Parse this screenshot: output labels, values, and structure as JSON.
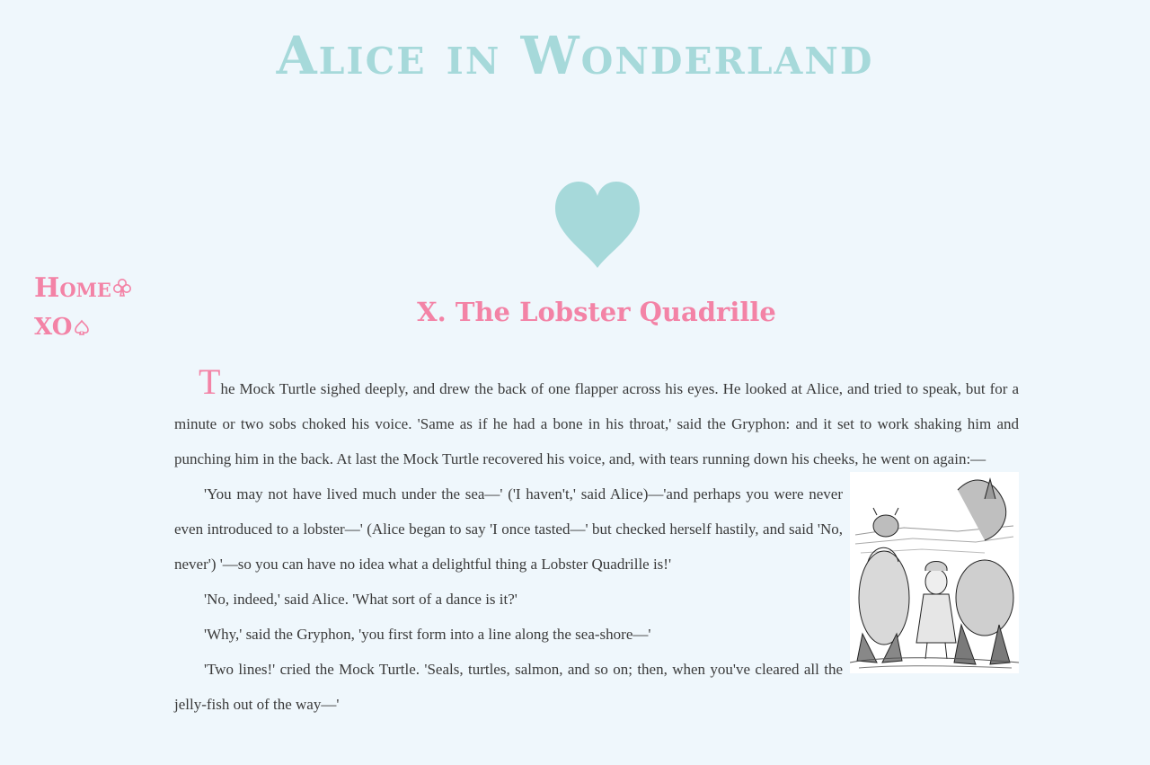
{
  "site": {
    "title": "Alice in Wonderland"
  },
  "nav": {
    "items": [
      {
        "label": "Home",
        "icon": "club-outline-icon"
      },
      {
        "label": "XO",
        "icon": "spade-outline-icon"
      }
    ]
  },
  "colors": {
    "background": "#eff7fc",
    "accent_teal": "#a6d9da",
    "accent_pink": "#f383a6",
    "body_text": "#3a3a3a"
  },
  "chapter": {
    "title": "X. The Lobster Quadrille",
    "drop_cap": "T",
    "paragraphs": [
      "he Mock Turtle sighed deeply, and drew the back of one flapper across his eyes. He looked at Alice, and tried to speak, but for a minute or two sobs choked his voice. 'Same as if he had a bone in his throat,' said the Gryphon: and it set to work shaking him and punching him in the back. At last the Mock Turtle recovered his voice, and, with tears running down his cheeks, he went on again:—",
      "'You may not have lived much under the sea—' ('I haven't,' said Alice)—'and perhaps you were never even introduced to a lobster—' (Alice began to say 'I once tasted—' but checked herself hastily, and said 'No, never') '—so you can have no idea what a delightful thing a Lobster Quadrille is!'",
      "'No, indeed,' said Alice. 'What sort of a dance is it?'",
      "'Why,' said the Gryphon, 'you first form into a line along the sea-shore—'",
      "'Two lines!' cried the Mock Turtle. 'Seals, turtles, salmon, and so on; then, when you've cleared all the jelly-fish out of the way—'"
    ]
  },
  "decor": {
    "heart_icon": "heart-icon",
    "illustration_icon": "mock-turtle-gryphon-alice-illustration"
  }
}
